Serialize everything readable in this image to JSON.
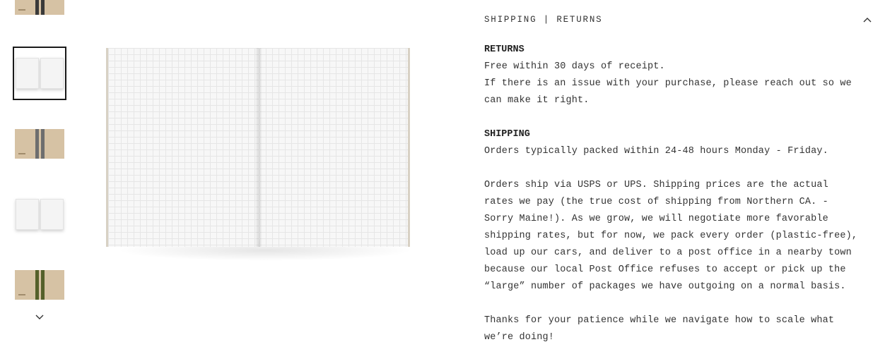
{
  "thumbnails": [
    {
      "name": "thumb-kraft-black",
      "kind": "kraft",
      "band_color": "#3a3a3a",
      "active": false
    },
    {
      "name": "thumb-open-grid",
      "kind": "open",
      "active": true
    },
    {
      "name": "thumb-kraft-gray",
      "kind": "kraft",
      "band_color": "#6e6e6e",
      "active": false
    },
    {
      "name": "thumb-open-blank",
      "kind": "open",
      "active": false
    },
    {
      "name": "thumb-kraft-olive",
      "kind": "kraft",
      "band_color": "#55602a",
      "active": false
    }
  ],
  "thumb_nav": {
    "icon": "chevron-down-icon"
  },
  "main_image": {
    "alt": "open grid notebook"
  },
  "accordion": {
    "title": "SHIPPING | RETURNS",
    "icon": "chevron-up-icon",
    "expanded": true
  },
  "returns": {
    "heading": "RETURNS",
    "line1": "Free within 30 days of receipt.",
    "line2": "If there is an issue with your purchase, please reach out so we",
    "line3": "can make it right."
  },
  "shipping": {
    "heading": "SHIPPING",
    "line1": "Orders typically packed within 24-48 hours Monday - Friday.",
    "para2": [
      "Orders ship via USPS or UPS. Shipping prices are the actual",
      "rates we pay (the true cost of shipping from Northern CA. -",
      "Sorry Maine!). As we grow, we will negotiate more favorable",
      "shipping rates, but for now, we pack every order (plastic-free),",
      "load up our cars, and deliver to a post office in a nearby town",
      "because our local Post Office refuses to accept or pick up the",
      "“large” number of packages we have outgoing on a normal basis."
    ],
    "para3": [
      "Thanks for your patience while we navigate how to scale what",
      "we’re doing!"
    ]
  }
}
